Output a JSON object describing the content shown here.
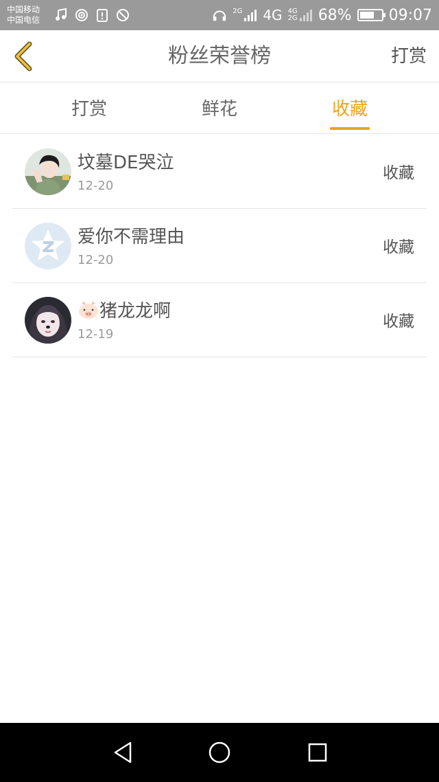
{
  "status_bar": {
    "carrier1": "中国移动",
    "carrier2": "中国电信",
    "network_2g": "2G",
    "network_4g": "4G",
    "network_4g2g_top": "4G",
    "network_4g2g_bottom": "2G",
    "battery_percent": "68%",
    "battery_level": 0.68,
    "time": "09:07",
    "icons": [
      "music-icon",
      "hotspot-icon",
      "storage-warning-icon",
      "blocked-icon",
      "headphones-icon",
      "signal-icon",
      "signal-icon",
      "battery-icon"
    ]
  },
  "header": {
    "title": "粉丝荣誉榜",
    "back_icon": "chevron-left-icon",
    "action_label": "打赏",
    "accent_color": "#f0a21b"
  },
  "tabs": [
    {
      "label": "打赏",
      "active": false
    },
    {
      "label": "鲜花",
      "active": false
    },
    {
      "label": "收藏",
      "active": true
    }
  ],
  "list": [
    {
      "name": "坟墓DE哭泣",
      "date": "12-20",
      "action": "收藏",
      "avatar": "user-photo-avatar"
    },
    {
      "name": "爱你不需理由",
      "date": "12-20",
      "action": "收藏",
      "avatar": "default-qq-avatar"
    },
    {
      "name": "猪龙龙啊",
      "date": "12-19",
      "action": "收藏",
      "avatar": "user-photo-avatar",
      "name_prefix_icon": "pig-emoji-icon"
    }
  ],
  "nav_bar": {
    "icons": [
      "back-triangle-icon",
      "home-circle-icon",
      "recents-square-icon"
    ]
  }
}
